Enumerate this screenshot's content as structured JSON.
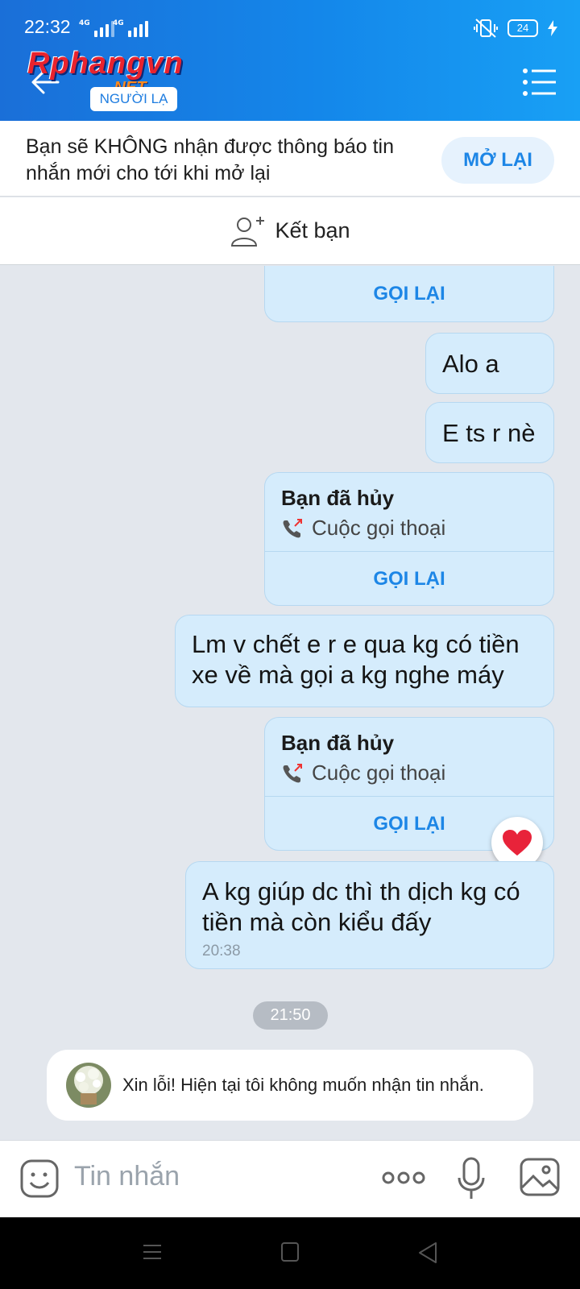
{
  "status_bar": {
    "time": "22:32",
    "net1": "4G",
    "net2": "4G",
    "battery": "24"
  },
  "header": {
    "logo_main": "Rphangvn",
    "logo_suffix": ".NET",
    "badge": "NGƯỜI LẠ"
  },
  "notice": {
    "text": "Bạn sẽ KHÔNG nhận được thông báo tin nhắn mới cho tới khi mở lại",
    "button": "MỞ LẠI"
  },
  "add_friend": {
    "label": "Kết bạn"
  },
  "messages": {
    "callback_label": "GỌI LẠI",
    "msg1": "Alo a",
    "msg2": "E ts r nè",
    "call1": {
      "title": "Bạn đã hủy",
      "subtitle": "Cuộc gọi thoại"
    },
    "msg3": "Lm v chết e r e qua kg có tiền xe về mà gọi a kg nghe máy",
    "call2": {
      "title": "Bạn đã hủy",
      "subtitle": "Cuộc gọi thoại"
    },
    "msg4": "A kg giúp dc thì th dịch kg có tiền mà còn kiểu đấy",
    "msg4_time": "20:38",
    "reaction": "heart",
    "time_divider": "21:50",
    "auto_reply": "Xin lỗi! Hiện tại tôi không muốn nhận tin nhắn."
  },
  "input": {
    "placeholder": "Tin nhắn"
  },
  "colors": {
    "header": "#1a7ee6",
    "bubble": "#d5ecfc",
    "accent": "#1d86e6",
    "chat_bg": "#e3e7ed"
  }
}
